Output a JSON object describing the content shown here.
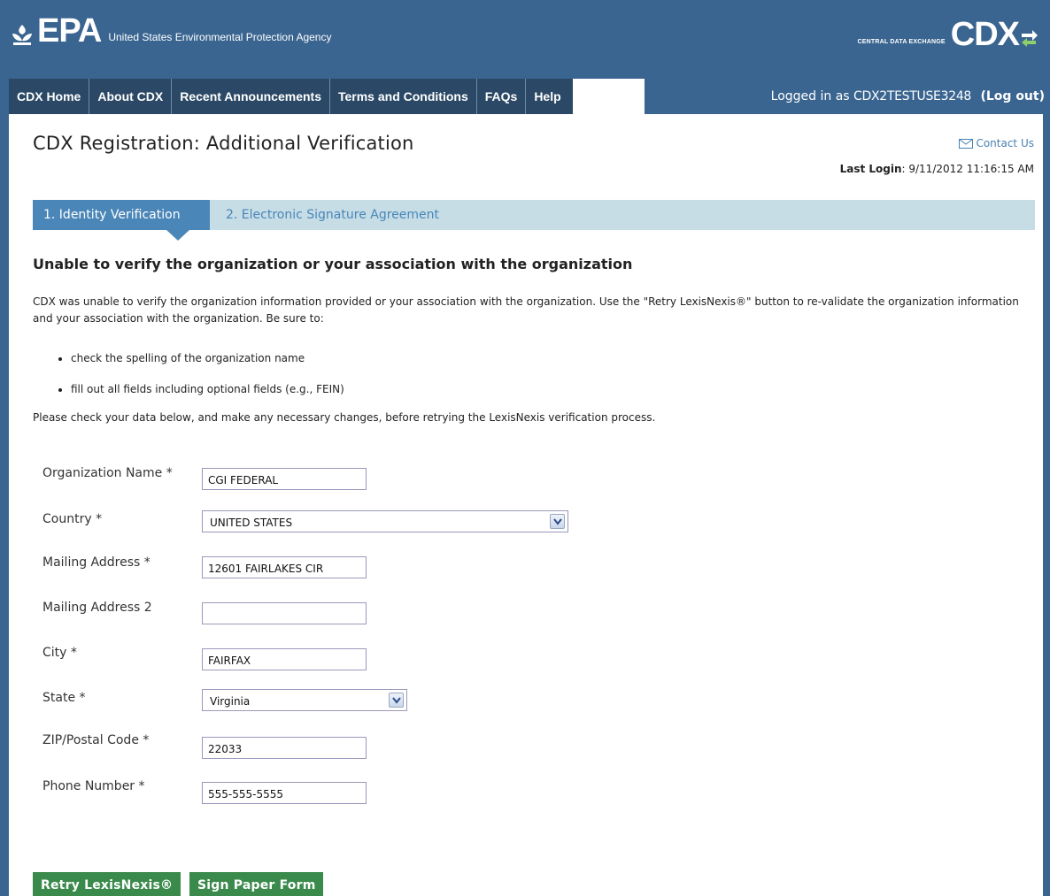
{
  "header": {
    "epa_logo_text": "EPA",
    "agency_name": "United States Environmental Protection Agency",
    "cdx_subtitle": "CENTRAL DATA EXCHANGE",
    "cdx_logo_text": "CDX"
  },
  "nav": {
    "items": [
      {
        "label": "CDX Home"
      },
      {
        "label": "About CDX"
      },
      {
        "label": "Recent Announcements"
      },
      {
        "label": "Terms and Conditions"
      },
      {
        "label": "FAQs"
      },
      {
        "label": "Help"
      }
    ],
    "logged_in_prefix": "Logged in as",
    "username": "CDX2TESTUSE3248",
    "logout_label": "(Log out)"
  },
  "page": {
    "title": "CDX Registration: Additional Verification",
    "contact_label": "Contact Us",
    "last_login_label": "Last Login",
    "last_login_value": ": 9/11/2012 11:16:15 AM"
  },
  "steps": {
    "step1": "1. Identity Verification",
    "step2": "2. Electronic Signature Agreement"
  },
  "message": {
    "heading": "Unable to verify the organization or your association with the organization",
    "paragraph": "CDX was unable to verify the organization information provided or your association with the organization. Use the \"Retry LexisNexis®\" button to re-validate the organization information and your association with the organization. Be sure to:",
    "bullets": [
      "check the spelling of the organization name",
      "fill out all fields including optional fields (e.g., FEIN)"
    ],
    "instruction": "Please check your data below, and make any necessary changes, before retrying the LexisNexis verification process."
  },
  "form": {
    "org_name_label": "Organization Name *",
    "org_name_value": "CGI FEDERAL",
    "country_label": "Country *",
    "country_value": "UNITED STATES",
    "address_label": "Mailing Address *",
    "address_value": "12601 FAIRLAKES CIR",
    "address2_label": "Mailing Address 2",
    "address2_value": "",
    "city_label": "City *",
    "city_value": "FAIRFAX",
    "state_label": "State *",
    "state_value": "Virginia",
    "zip_label": "ZIP/Postal Code *",
    "zip_value": "22033",
    "phone_label": "Phone Number *",
    "phone_value": "555-555-5555"
  },
  "actions": {
    "retry_label": "Retry LexisNexis®",
    "paper_label": "Sign Paper Form"
  }
}
